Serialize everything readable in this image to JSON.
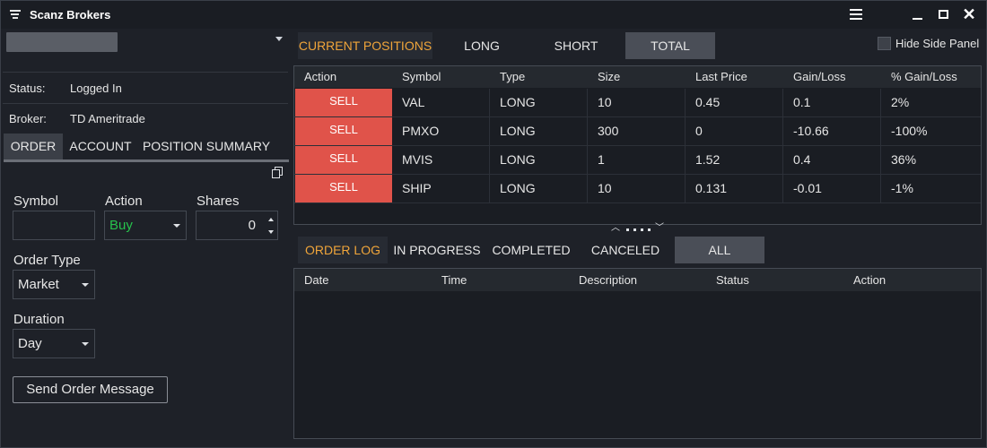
{
  "window": {
    "title": "Scanz Brokers"
  },
  "account": {
    "status_label": "Status:",
    "status_value": "Logged In",
    "broker_label": "Broker:",
    "broker_value": "TD Ameritrade"
  },
  "left_tabs": [
    "ORDER",
    "ACCOUNT",
    "POSITION SUMMARY"
  ],
  "order_form": {
    "symbol_label": "Symbol",
    "symbol_value": "",
    "action_label": "Action",
    "action_value": "Buy",
    "shares_label": "Shares",
    "shares_value": "0",
    "order_type_label": "Order Type",
    "order_type_value": "Market",
    "duration_label": "Duration",
    "duration_value": "Day",
    "send_button": "Send Order Message"
  },
  "positions_tabs": [
    "CURRENT POSITIONS",
    "LONG",
    "SHORT",
    "TOTAL"
  ],
  "hide_side_panel": "Hide Side Panel",
  "positions": {
    "columns": [
      "Action",
      "Symbol",
      "Type",
      "Size",
      "Last Price",
      "Gain/Loss",
      "% Gain/Loss"
    ],
    "rows": [
      {
        "action": "SELL",
        "symbol": "VAL",
        "type": "LONG",
        "size": "10",
        "last_price": "0.45",
        "gain_loss": "0.1",
        "pct_gain_loss": "2%"
      },
      {
        "action": "SELL",
        "symbol": "PMXO",
        "type": "LONG",
        "size": "300",
        "last_price": "0",
        "gain_loss": "-10.66",
        "pct_gain_loss": "-100%"
      },
      {
        "action": "SELL",
        "symbol": "MVIS",
        "type": "LONG",
        "size": "1",
        "last_price": "1.52",
        "gain_loss": "0.4",
        "pct_gain_loss": "36%"
      },
      {
        "action": "SELL",
        "symbol": "SHIP",
        "type": "LONG",
        "size": "10",
        "last_price": "0.131",
        "gain_loss": "-0.01",
        "pct_gain_loss": "-1%"
      }
    ]
  },
  "order_log_tabs": [
    "ORDER LOG",
    "IN PROGRESS",
    "COMPLETED",
    "CANCELED",
    "ALL"
  ],
  "order_log": {
    "columns": [
      "Date",
      "Time",
      "Description",
      "Status",
      "Action"
    ]
  },
  "colors": {
    "accent": "#f0a53a",
    "sell": "#e0534a",
    "buy": "#27c24c",
    "background": "#1e2128"
  }
}
